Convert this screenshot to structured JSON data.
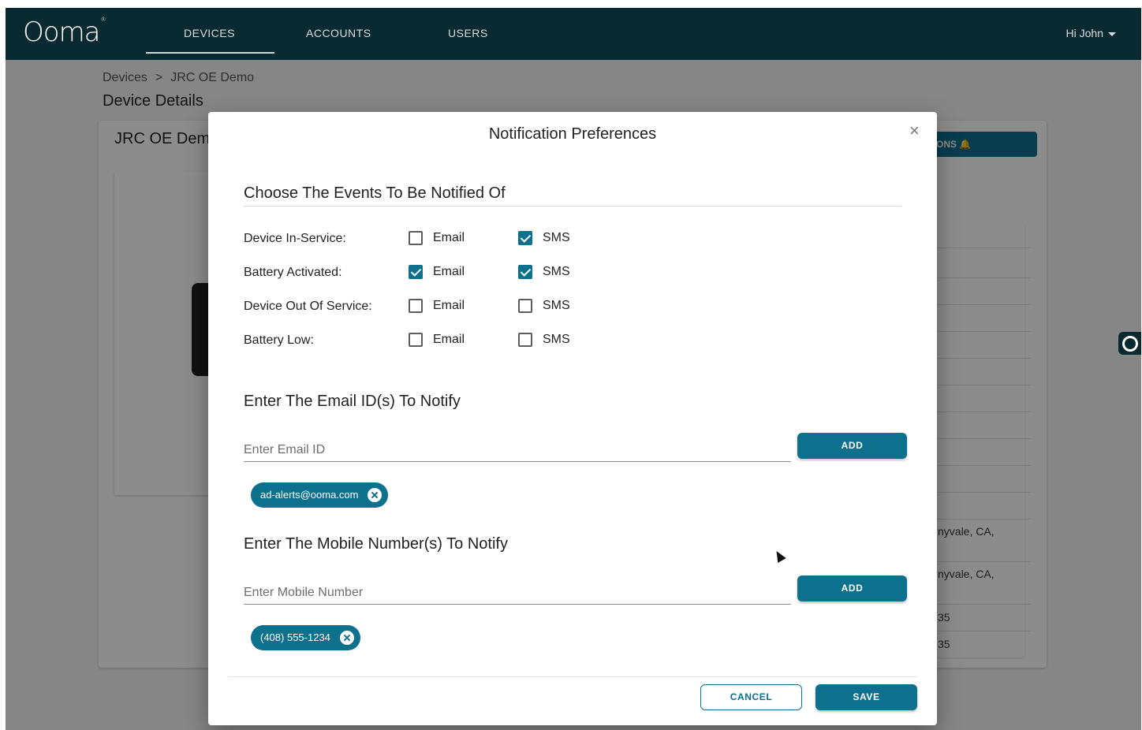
{
  "nav": {
    "logo": "Ooma",
    "logo_mark": "®",
    "tabs": [
      "DEVICES",
      "ACCOUNTS",
      "USERS"
    ],
    "active_tab": "DEVICES",
    "user_greeting": "Hi John"
  },
  "page": {
    "breadcrumb_root": "Devices",
    "breadcrumb_separator": ">",
    "breadcrumb_current": "JRC OE Demo",
    "title": "Device Details",
    "card_title": "JRC OE Dem",
    "notifications_button_partial": "ONS",
    "table_fragments": [
      "nyvale, CA,",
      "nyvale, CA,",
      "35",
      "35"
    ]
  },
  "modal": {
    "title": "Notification Preferences",
    "close_symbol": "×",
    "events_heading": "Choose The Events To Be Notified Of",
    "events": [
      {
        "label": "Device In-Service:",
        "email": false,
        "sms": true
      },
      {
        "label": "Battery Activated:",
        "email": true,
        "sms": true
      },
      {
        "label": "Device Out Of Service:",
        "email": false,
        "sms": false
      },
      {
        "label": "Battery Low:",
        "email": false,
        "sms": false
      }
    ],
    "email_option_label": "Email",
    "sms_option_label": "SMS",
    "email_heading": "Enter The Email ID(s) To Notify",
    "email_placeholder": "Enter Email ID",
    "email_add_label": "ADD",
    "email_chips": [
      "ad-alerts@ooma.com"
    ],
    "mobile_heading": "Enter The Mobile Number(s) To Notify",
    "mobile_placeholder": "Enter Mobile Number",
    "mobile_add_label": "ADD",
    "mobile_chips": [
      "(408) 555-1234"
    ],
    "cancel_label": "CANCEL",
    "save_label": "SAVE"
  },
  "colors": {
    "nav_bg": "#092a30",
    "accent": "#0d708d",
    "overlay": "rgba(0,0,0,0.45)"
  }
}
